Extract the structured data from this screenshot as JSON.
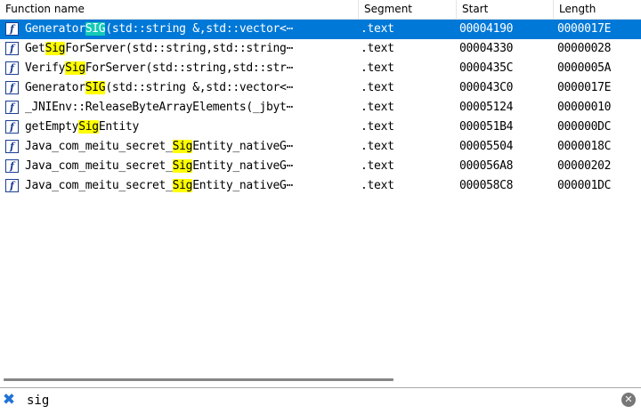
{
  "columns": [
    "Function name",
    "Segment",
    "Start",
    "Length"
  ],
  "icon_glyph": "f",
  "rows": [
    {
      "pre": "Generator",
      "hl": "SIG",
      "post": "(std::string &,std::vector<⋯",
      "segment": ".text",
      "start": "00004190",
      "length": "0000017E",
      "selected": true
    },
    {
      "pre": "Get",
      "hl": "Sig",
      "post": "ForServer(std::string,std::string⋯",
      "segment": ".text",
      "start": "00004330",
      "length": "00000028",
      "selected": false
    },
    {
      "pre": "Verify",
      "hl": "Sig",
      "post": "ForServer(std::string,std::str⋯",
      "segment": ".text",
      "start": "0000435C",
      "length": "0000005A",
      "selected": false
    },
    {
      "pre": "Generator",
      "hl": "SIG",
      "post": "(std::string &,std::vector<⋯",
      "segment": ".text",
      "start": "000043C0",
      "length": "0000017E",
      "selected": false
    },
    {
      "pre": "_JNIEnv::ReleaseByteArrayElements(_jbyt⋯",
      "hl": "",
      "post": "",
      "segment": ".text",
      "start": "00005124",
      "length": "00000010",
      "selected": false
    },
    {
      "pre": "getEmpty",
      "hl": "Sig",
      "post": "Entity",
      "segment": ".text",
      "start": "000051B4",
      "length": "000000DC",
      "selected": false
    },
    {
      "pre": "Java_com_meitu_secret_",
      "hl": "Sig",
      "post": "Entity_nativeG⋯",
      "segment": ".text",
      "start": "00005504",
      "length": "0000018C",
      "selected": false
    },
    {
      "pre": "Java_com_meitu_secret_",
      "hl": "Sig",
      "post": "Entity_nativeG⋯",
      "segment": ".text",
      "start": "000056A8",
      "length": "00000202",
      "selected": false
    },
    {
      "pre": "Java_com_meitu_secret_",
      "hl": "Sig",
      "post": "Entity_nativeG⋯",
      "segment": ".text",
      "start": "000058C8",
      "length": "000001DC",
      "selected": false
    }
  ],
  "search": {
    "value": "sig",
    "close_glyph": "✖",
    "clear_glyph": "✕"
  },
  "colors": {
    "selection": "#0078d7",
    "highlight": "#ffff00",
    "selected_highlight": "#13c9b6",
    "icon_blue": "#1c3f95"
  }
}
